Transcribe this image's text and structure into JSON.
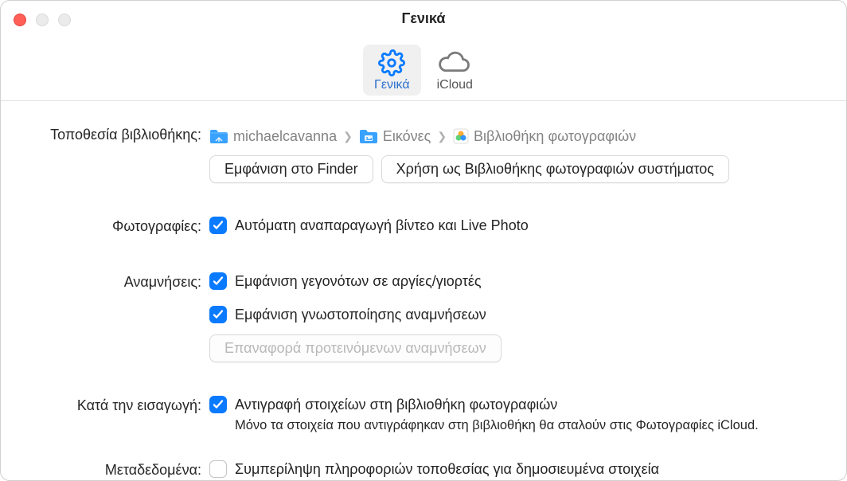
{
  "window": {
    "title": "Γενικά"
  },
  "tabs": {
    "general": "Γενικά",
    "icloud": "iCloud"
  },
  "labels": {
    "library_location": "Τοποθεσία βιβλιοθήκης:",
    "photos": "Φωτογραφίες:",
    "memories": "Αναμνήσεις:",
    "importing": "Κατά την εισαγωγή:",
    "metadata": "Μεταδεδομένα:"
  },
  "breadcrumb": {
    "home": "michaelcavanna",
    "pictures": "Εικόνες",
    "library": "Βιβλιοθήκη φωτογραφιών"
  },
  "buttons": {
    "show_in_finder": "Εμφάνιση στο Finder",
    "use_as_system_library": "Χρήση ως Βιβλιοθήκης φωτογραφιών συστήματος",
    "reset_memories": "Επαναφορά προτεινόμενων αναμνήσεων"
  },
  "checkboxes": {
    "autoplay": "Αυτόματη αναπαραγωγή βίντεο και Live Photo",
    "holiday_events": "Εμφάνιση γεγονότων σε αργίες/γιορτές",
    "memories_notification": "Εμφάνιση γνωστοποίησης αναμνήσεων",
    "copy_on_import": "Αντιγραφή στοιχείων στη βιβλιοθήκη φωτογραφιών",
    "include_location": "Συμπερίληψη πληροφοριών τοποθεσίας για δημοσιευμένα στοιχεία"
  },
  "help": {
    "copy_on_import": "Μόνο τα στοιχεία που αντιγράφηκαν στη βιβλιοθήκη θα σταλούν στις Φωτογραφίες iCloud."
  }
}
